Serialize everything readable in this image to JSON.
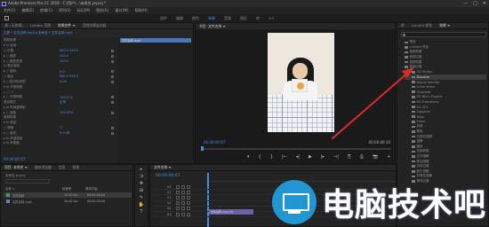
{
  "window": {
    "title": "Adobe Premiere Pro CC 2018 - C:\\用户\\...\\未命名.prproj *",
    "controls": [
      "—",
      "□",
      "✕"
    ]
  },
  "menu": [
    "文件(F)",
    "编辑(E)",
    "剪辑(C)",
    "序列(S)",
    "标记(M)",
    "图形(G)",
    "窗口(W)",
    "帮助(H)"
  ],
  "workspaces": {
    "tabs": [
      "组件",
      "编辑",
      "颜色",
      "效果",
      "音频",
      "图形",
      "库",
      ">>"
    ],
    "active_index": 3
  },
  "effect_controls": {
    "tabs": [
      "源: (无剪辑)",
      "Lumetri 范围",
      "效果控件 ≡",
      "音频剪辑混合器"
    ],
    "active_index": 2,
    "header": "主要 * 文件名称.mp4  ▸  未命名 * 文件名称.mp4",
    "clip_label": "文件名称.mp4",
    "rows": [
      {
        "label": "视频效果",
        "value": ""
      },
      {
        "label": "▾ fx 运动",
        "value": ""
      },
      {
        "label": "   ○ 位置",
        "value": "960.0   540.0"
      },
      {
        "label": " ▸ ○ 缩放",
        "value": "100.0"
      },
      {
        "label": " ▸ ○ 缩放宽度",
        "value": "100.0"
      },
      {
        "label": "      ☑ 等比缩放",
        "value": ""
      },
      {
        "label": " ▸ ○ 旋转",
        "value": "0.0"
      },
      {
        "label": "   ○ 锚点",
        "value": "960.0   540.0"
      },
      {
        "label": " ▸ ○ 防闪烁滤镜",
        "value": "0.00"
      },
      {
        "label": "▾ fx 不透明度",
        "value": ""
      },
      {
        "label": "   ○ □ ✎",
        "value": ""
      },
      {
        "label": " ▸ ○ 不透明度",
        "value": "100.0 %"
      },
      {
        "label": "   混合模式",
        "value": "正常"
      },
      {
        "label": "▸ fx 时间重映射",
        "value": ""
      },
      {
        "label": " ▸ ○ 速度",
        "value": "100.00%"
      },
      {
        "label": "音频效果",
        "value": ""
      },
      {
        "label": "▾ fx 音量",
        "value": ""
      },
      {
        "label": "   ○ 旁路",
        "value": "☐"
      },
      {
        "label": " ▸ ○ 级别",
        "value": "0.0 dB"
      },
      {
        "label": "▸ fx 声道音量",
        "value": ""
      },
      {
        "label": "▸ fx 声像器",
        "value": ""
      }
    ],
    "time": "00:00:00:07"
  },
  "program": {
    "tab": "节目: 文件名称 ≡",
    "time_left": "00:00:00:07",
    "fit": "适合",
    "quality": "完整",
    "time_right": "00:00:00:10",
    "controls": [
      "▾",
      "{",
      "}",
      "|←",
      "◂|",
      "▶",
      "|▸",
      "→|",
      "⎘",
      "⎙",
      "📷",
      "+"
    ]
  },
  "effects_browser": {
    "tabs": [
      "库",
      "Lumetri 颜色",
      "效果 ≡"
    ],
    "active_index": 2,
    "items": [
      {
        "label": "预设",
        "level": 0,
        "selected": false
      },
      {
        "label": "Lumetri 预设",
        "level": 0,
        "selected": false
      },
      {
        "label": "音频效果",
        "level": 0,
        "selected": false
      },
      {
        "label": "音频过渡",
        "level": 0,
        "selected": false
      },
      {
        "label": "视频效果",
        "level": 0,
        "selected": false
      },
      {
        "label": "视频过渡",
        "level": 0,
        "selected": false
      },
      {
        "label": "3D Motion",
        "level": 1,
        "selected": false
      },
      {
        "label": "Dissolve",
        "level": 1,
        "selected": true
      },
      {
        "label": "Digital Identity",
        "level": 1,
        "selected": false
      },
      {
        "label": "Grain Video",
        "level": 1,
        "selected": false
      },
      {
        "label": "Obsolete",
        "level": 1,
        "selected": false
      },
      {
        "label": "RG Blurs Plugins",
        "level": 1,
        "selected": false
      },
      {
        "label": "RG Transitions",
        "level": 1,
        "selected": false
      },
      {
        "label": "RG VFX",
        "level": 1,
        "selected": false
      },
      {
        "label": "Sapphire",
        "level": 1,
        "selected": false
      },
      {
        "label": "Wipe",
        "level": 1,
        "selected": false
      },
      {
        "label": "Zoom",
        "level": 1,
        "selected": false
      },
      {
        "label": "划像",
        "level": 1,
        "selected": false
      },
      {
        "label": "擦除",
        "level": 1,
        "selected": false
      },
      {
        "label": "沉浸式视频",
        "level": 1,
        "selected": false
      },
      {
        "label": "溶解",
        "level": 1,
        "selected": false
      },
      {
        "label": "缩放",
        "level": 1,
        "selected": false
      },
      {
        "label": "页面剥落",
        "level": 1,
        "selected": false
      },
      {
        "label": "交叉溶解",
        "level": 1,
        "selected": false
      },
      {
        "label": "叠加溶解",
        "level": 1,
        "selected": false
      },
      {
        "label": "白场过渡",
        "level": 1,
        "selected": false
      },
      {
        "label": "胶片溶解",
        "level": 1,
        "selected": false
      },
      {
        "label": "非叠加溶解",
        "level": 1,
        "selected": false
      },
      {
        "label": "黑场过渡",
        "level": 1,
        "selected": false
      }
    ]
  },
  "project": {
    "tabs": [
      "项目: 未命名 ≡",
      "媒体浏览器",
      "信息",
      "效果"
    ],
    "active_index": 0,
    "title": "未命名.prproj",
    "columns": [
      "名称 ∧",
      "帧速率",
      "媒体开始"
    ],
    "rows": [
      {
        "name": "文件名称",
        "fps": "30.00 fps",
        "start": "00:00:00:00",
        "swatch": "#3aa64c",
        "selected": true
      },
      {
        "name": "文件名称.mp4",
        "fps": "30.00 fps",
        "start": "00:00:00:00",
        "swatch": "#5b85c8",
        "selected": false
      }
    ]
  },
  "tools": [
    "▸",
    "⇉",
    "✥",
    "⊞",
    "✎",
    "✋",
    "T"
  ],
  "timeline": {
    "tab": "文件名称 ≡",
    "time": "00:00:00:07",
    "tracks": [
      {
        "name": "V3"
      },
      {
        "name": "V2"
      },
      {
        "name": "V1"
      },
      {
        "name": "A1"
      },
      {
        "name": "A2"
      },
      {
        "name": "A3"
      }
    ],
    "clip": "文件名称.mp4 [V]"
  },
  "watermark": {
    "text": "电脑技术吧"
  },
  "colors": {
    "accent": "#3b8dea",
    "annotation": "#d92b2b"
  }
}
